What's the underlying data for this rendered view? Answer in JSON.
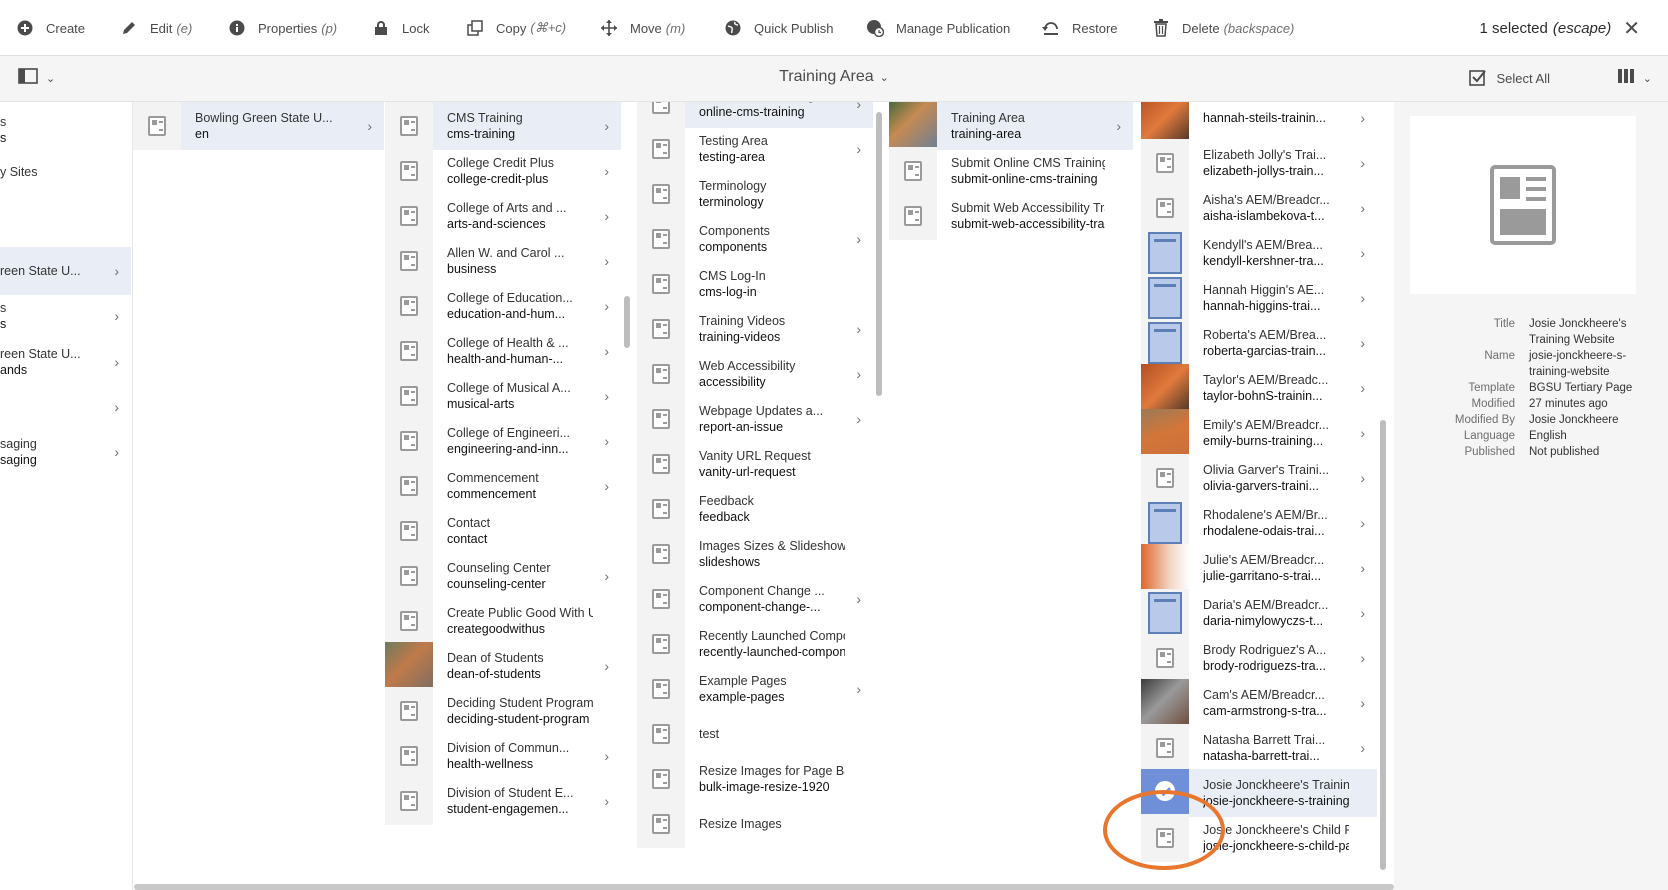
{
  "toolbar": {
    "create": "Create",
    "edit": "Edit",
    "edit_sc": "(e)",
    "properties": "Properties",
    "properties_sc": "(p)",
    "lock": "Lock",
    "copy": "Copy",
    "copy_sc": "(⌘+c)",
    "move": "Move",
    "move_sc": "(m)",
    "quick_publish": "Quick Publish",
    "manage_publication": "Manage Publication",
    "restore": "Restore",
    "delete": "Delete",
    "delete_sc": "(backspace)",
    "selected": "1 selected",
    "selected_sc": "(escape)"
  },
  "actionbar": {
    "title": "Training Area",
    "select_all": "Select All"
  },
  "col0": [
    {
      "t1": "s",
      "t2": "s"
    },
    {
      "t1": "y Sites",
      "t2": ""
    },
    {
      "t1": "reen State U...",
      "t2": ""
    },
    {
      "t1": "s",
      "t2": "s"
    },
    {
      "t1": "reen State U...",
      "t2": "ands"
    },
    {
      "t1": "",
      "t2": ""
    },
    {
      "t1": "saging",
      "t2": "saging"
    }
  ],
  "col1": [
    {
      "t1": "Bowling Green State U...",
      "t2": "en"
    }
  ],
  "col2": [
    {
      "t1": "CMS Training",
      "t2": "cms-training"
    },
    {
      "t1": "College Credit Plus",
      "t2": "college-credit-plus"
    },
    {
      "t1": "College of Arts and ...",
      "t2": "arts-and-sciences"
    },
    {
      "t1": "Allen W. and Carol ...",
      "t2": "business"
    },
    {
      "t1": "College of Education...",
      "t2": "education-and-hum..."
    },
    {
      "t1": "College of Health & ...",
      "t2": "health-and-human-..."
    },
    {
      "t1": "College of Musical A...",
      "t2": "musical-arts"
    },
    {
      "t1": "College of Engineeri...",
      "t2": "engineering-and-inn..."
    },
    {
      "t1": "Commencement",
      "t2": "commencement"
    },
    {
      "t1": "Contact",
      "t2": "contact"
    },
    {
      "t1": "Counseling Center",
      "t2": "counseling-center"
    },
    {
      "t1": "Create Public Good With Us",
      "t2": "creategoodwithus"
    },
    {
      "t1": "Dean of Students",
      "t2": "dean-of-students"
    },
    {
      "t1": "Deciding Student Program",
      "t2": "deciding-student-program"
    },
    {
      "t1": "Division of Commun...",
      "t2": "health-wellness"
    },
    {
      "t1": "Division of Student E...",
      "t2": "student-engagemen..."
    }
  ],
  "col3": [
    {
      "t1": "Online CMS Training",
      "t2": "online-cms-training"
    },
    {
      "t1": "Testing Area",
      "t2": "testing-area"
    },
    {
      "t1": "Terminology",
      "t2": "terminology"
    },
    {
      "t1": "Components",
      "t2": "components"
    },
    {
      "t1": "CMS Log-In",
      "t2": "cms-log-in"
    },
    {
      "t1": "Training Videos",
      "t2": "training-videos"
    },
    {
      "t1": "Web Accessibility",
      "t2": "accessibility"
    },
    {
      "t1": "Webpage Updates a...",
      "t2": "report-an-issue"
    },
    {
      "t1": "Vanity URL Request",
      "t2": "vanity-url-request"
    },
    {
      "t1": "Feedback",
      "t2": "feedback"
    },
    {
      "t1": "Images Sizes & Slideshows",
      "t2": "slideshows"
    },
    {
      "t1": "Component Change ...",
      "t2": "component-change-..."
    },
    {
      "t1": "Recently Launched Compo...",
      "t2": "recently-launched-compon..."
    },
    {
      "t1": "Example Pages",
      "t2": "example-pages"
    },
    {
      "t1": "test",
      "t2": ""
    },
    {
      "t1": "Resize Images for Page Ban...",
      "t2": "bulk-image-resize-1920"
    },
    {
      "t1": "Resize Images",
      "t2": ""
    }
  ],
  "col4": [
    {
      "t1": "Training Area",
      "t2": "training-area"
    },
    {
      "t1": "Submit Online CMS Training",
      "t2": "submit-online-cms-training"
    },
    {
      "t1": "Submit Web Accessibility Train...",
      "t2": "submit-web-accessibility-traini..."
    }
  ],
  "col5": [
    {
      "t1": "",
      "t2": "hannah-steils-trainin..."
    },
    {
      "t1": "Elizabeth Jolly's Trai...",
      "t2": "elizabeth-jollys-train..."
    },
    {
      "t1": "Aisha's AEM/Breadcr...",
      "t2": "aisha-islambekova-t..."
    },
    {
      "t1": "Kendyll's AEM/Brea...",
      "t2": "kendyll-kershner-tra..."
    },
    {
      "t1": "Hannah Higgin's AE...",
      "t2": "hannah-higgins-trai..."
    },
    {
      "t1": "Roberta's AEM/Brea...",
      "t2": "roberta-garcias-train..."
    },
    {
      "t1": "Taylor's AEM/Breadc...",
      "t2": "taylor-bohnS-trainin..."
    },
    {
      "t1": "Emily's AEM/Breadcr...",
      "t2": "emily-burns-training..."
    },
    {
      "t1": "Olivia Garver's Traini...",
      "t2": "olivia-garvers-traini..."
    },
    {
      "t1": "Rhodalene's AEM/Br...",
      "t2": "rhodalene-odais-trai..."
    },
    {
      "t1": "Julie's AEM/Breadcr...",
      "t2": "julie-garritano-s-trai..."
    },
    {
      "t1": "Daria's AEM/Breadcr...",
      "t2": "daria-nimylowyczs-t..."
    },
    {
      "t1": "Brody Rodriguez's A...",
      "t2": "brody-rodriguezs-tra..."
    },
    {
      "t1": "Cam's AEM/Breadcr...",
      "t2": "cam-armstrong-s-tra..."
    },
    {
      "t1": "Natasha Barrett Trai...",
      "t2": "natasha-barrett-trai..."
    },
    {
      "t1": "Josie Jonckheere's Training ...",
      "t2": "josie-jonckheere-s-training-..."
    },
    {
      "t1": "Josie Jonckheere's Child Page",
      "t2": "josie-jonckheere-s-child-page"
    }
  ],
  "preview": {
    "rows": [
      {
        "k": "Title",
        "v": "Josie Jonckheere's Training Website"
      },
      {
        "k": "Name",
        "v": "josie-jonckheere-s-training-website"
      },
      {
        "k": "Template",
        "v": "BGSU Tertiary Page"
      },
      {
        "k": "Modified",
        "v": "27 minutes ago"
      },
      {
        "k": "Modified By",
        "v": "Josie Jonckheere"
      },
      {
        "k": "Language",
        "v": "English"
      },
      {
        "k": "Published",
        "v": "Not published"
      }
    ]
  },
  "colors": {
    "accent": "#e8762d",
    "selection": "#e9eef6"
  }
}
